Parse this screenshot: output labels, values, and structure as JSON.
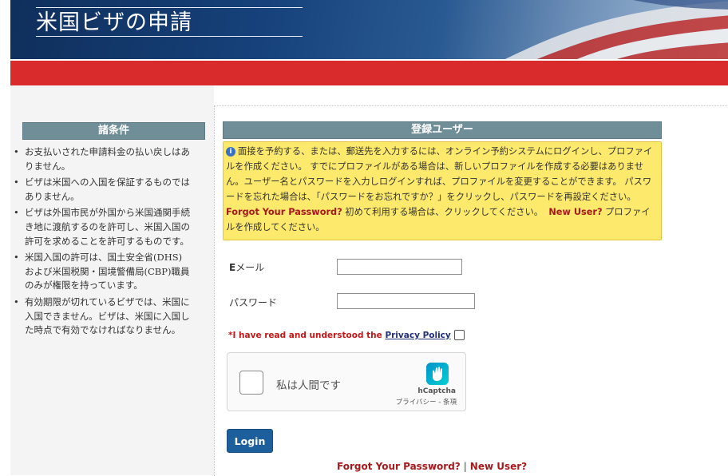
{
  "header": {
    "title": "米国ビザの申請"
  },
  "sidebar": {
    "heading": "諸条件",
    "items": [
      "お支払いされた申請料金の払い戻しはありません。",
      "ビザは米国への入国を保証するものではありません。",
      "ビザは外国市民が外国から米国通関手続き地に渡航するのを許可し、米国入国の許可を求めることを許可するものです。",
      "米国入国の許可は、国土安全省(DHS)および米国税関・国境警備局(CBP)職員のみが権限を持っています。",
      "有効期限が切れているビザでは、米国に入国できません。ビザは、米国に入国した時点で有効でなければなりません。"
    ]
  },
  "main": {
    "heading": "登録ユーザー",
    "notice": {
      "text1": "面接を予約する、または、郵送先を入力するには、オンライン予約システムにログインし、プロファイルを作成ください。 すでにプロファイルがある場合は、新しいプロファイルを作成する必要はありません。ユーザー名とパスワードを入力しログインすれば、プロファイルを変更することができます。 パスワードを忘れた場合は、「パスワードをお忘れですか？」をクリックし、パスワードを再設定ください。",
      "forgot_link": "Forgot Your Password?",
      "text2": "初めて利用する場合は、クリックしてください。",
      "new_user_link": "New User?",
      "text3": "プロファイルを作成してください。"
    },
    "email_label_prefix": "E",
    "email_label_rest": "メール",
    "email_value": "",
    "password_label": "パスワード",
    "password_value": "",
    "privacy": {
      "prefix": "*I have read and understood the ",
      "link": "Privacy Policy",
      "checked": false
    },
    "captcha": {
      "label": "私は人間です",
      "brand": "hCaptcha",
      "links": "プライバシー - 条項"
    },
    "login_label": "Login",
    "bottom_links": {
      "forgot": "Forgot Your Password?",
      "separator": "|",
      "new_user": "New User?"
    }
  },
  "colors": {
    "red_bar": "#d92b2b",
    "header_bar": "#6f8e97",
    "notice_bg": "#fde96b",
    "link_red": "#a8191b",
    "button_blue": "#1d5f9c"
  }
}
